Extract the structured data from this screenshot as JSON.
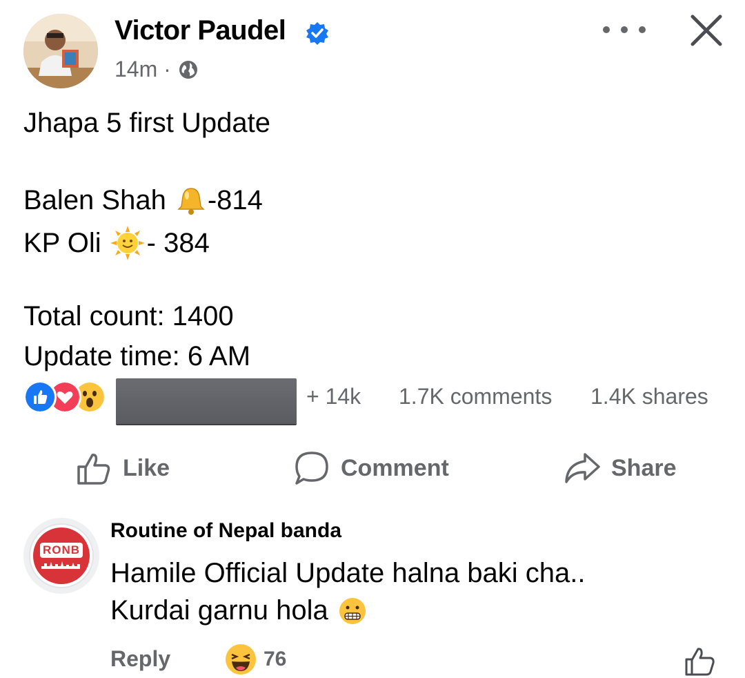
{
  "post": {
    "author": "Victor Paudel",
    "time": "14m ·",
    "lines": {
      "heading": "Jhapa 5 first Update",
      "balen_name": "Balen Shah",
      "balen_value": "-814",
      "kp_name": "KP Oli",
      "kp_value": "- 384",
      "total": "Total count: 1400",
      "update_time": "Update time: 6 AM"
    }
  },
  "stats": {
    "reactions": "+ 14k",
    "comments": "1.7K comments",
    "shares": "1.4K shares"
  },
  "actions": {
    "like": "Like",
    "comment": "Comment",
    "share": "Share"
  },
  "comment": {
    "avatar_text": "RONB",
    "author": "Routine of Nepal banda",
    "line1": "Hamile Official Update halna baki cha..",
    "line2": "Kurdai garnu hola",
    "reply": "Reply",
    "reaction_count": "76"
  },
  "colors": {
    "accent": "#1877f2",
    "text": "#050505",
    "secondary": "#65676b"
  },
  "icons": [
    "verified-badge-icon",
    "globe-icon",
    "more-icon",
    "close-icon",
    "bell-emoji-icon",
    "sun-emoji-icon",
    "like-reaction-icon",
    "love-reaction-icon",
    "wow-reaction-icon",
    "like-icon",
    "comment-icon",
    "share-icon",
    "grimace-emoji-icon",
    "laugh-emoji-icon"
  ]
}
